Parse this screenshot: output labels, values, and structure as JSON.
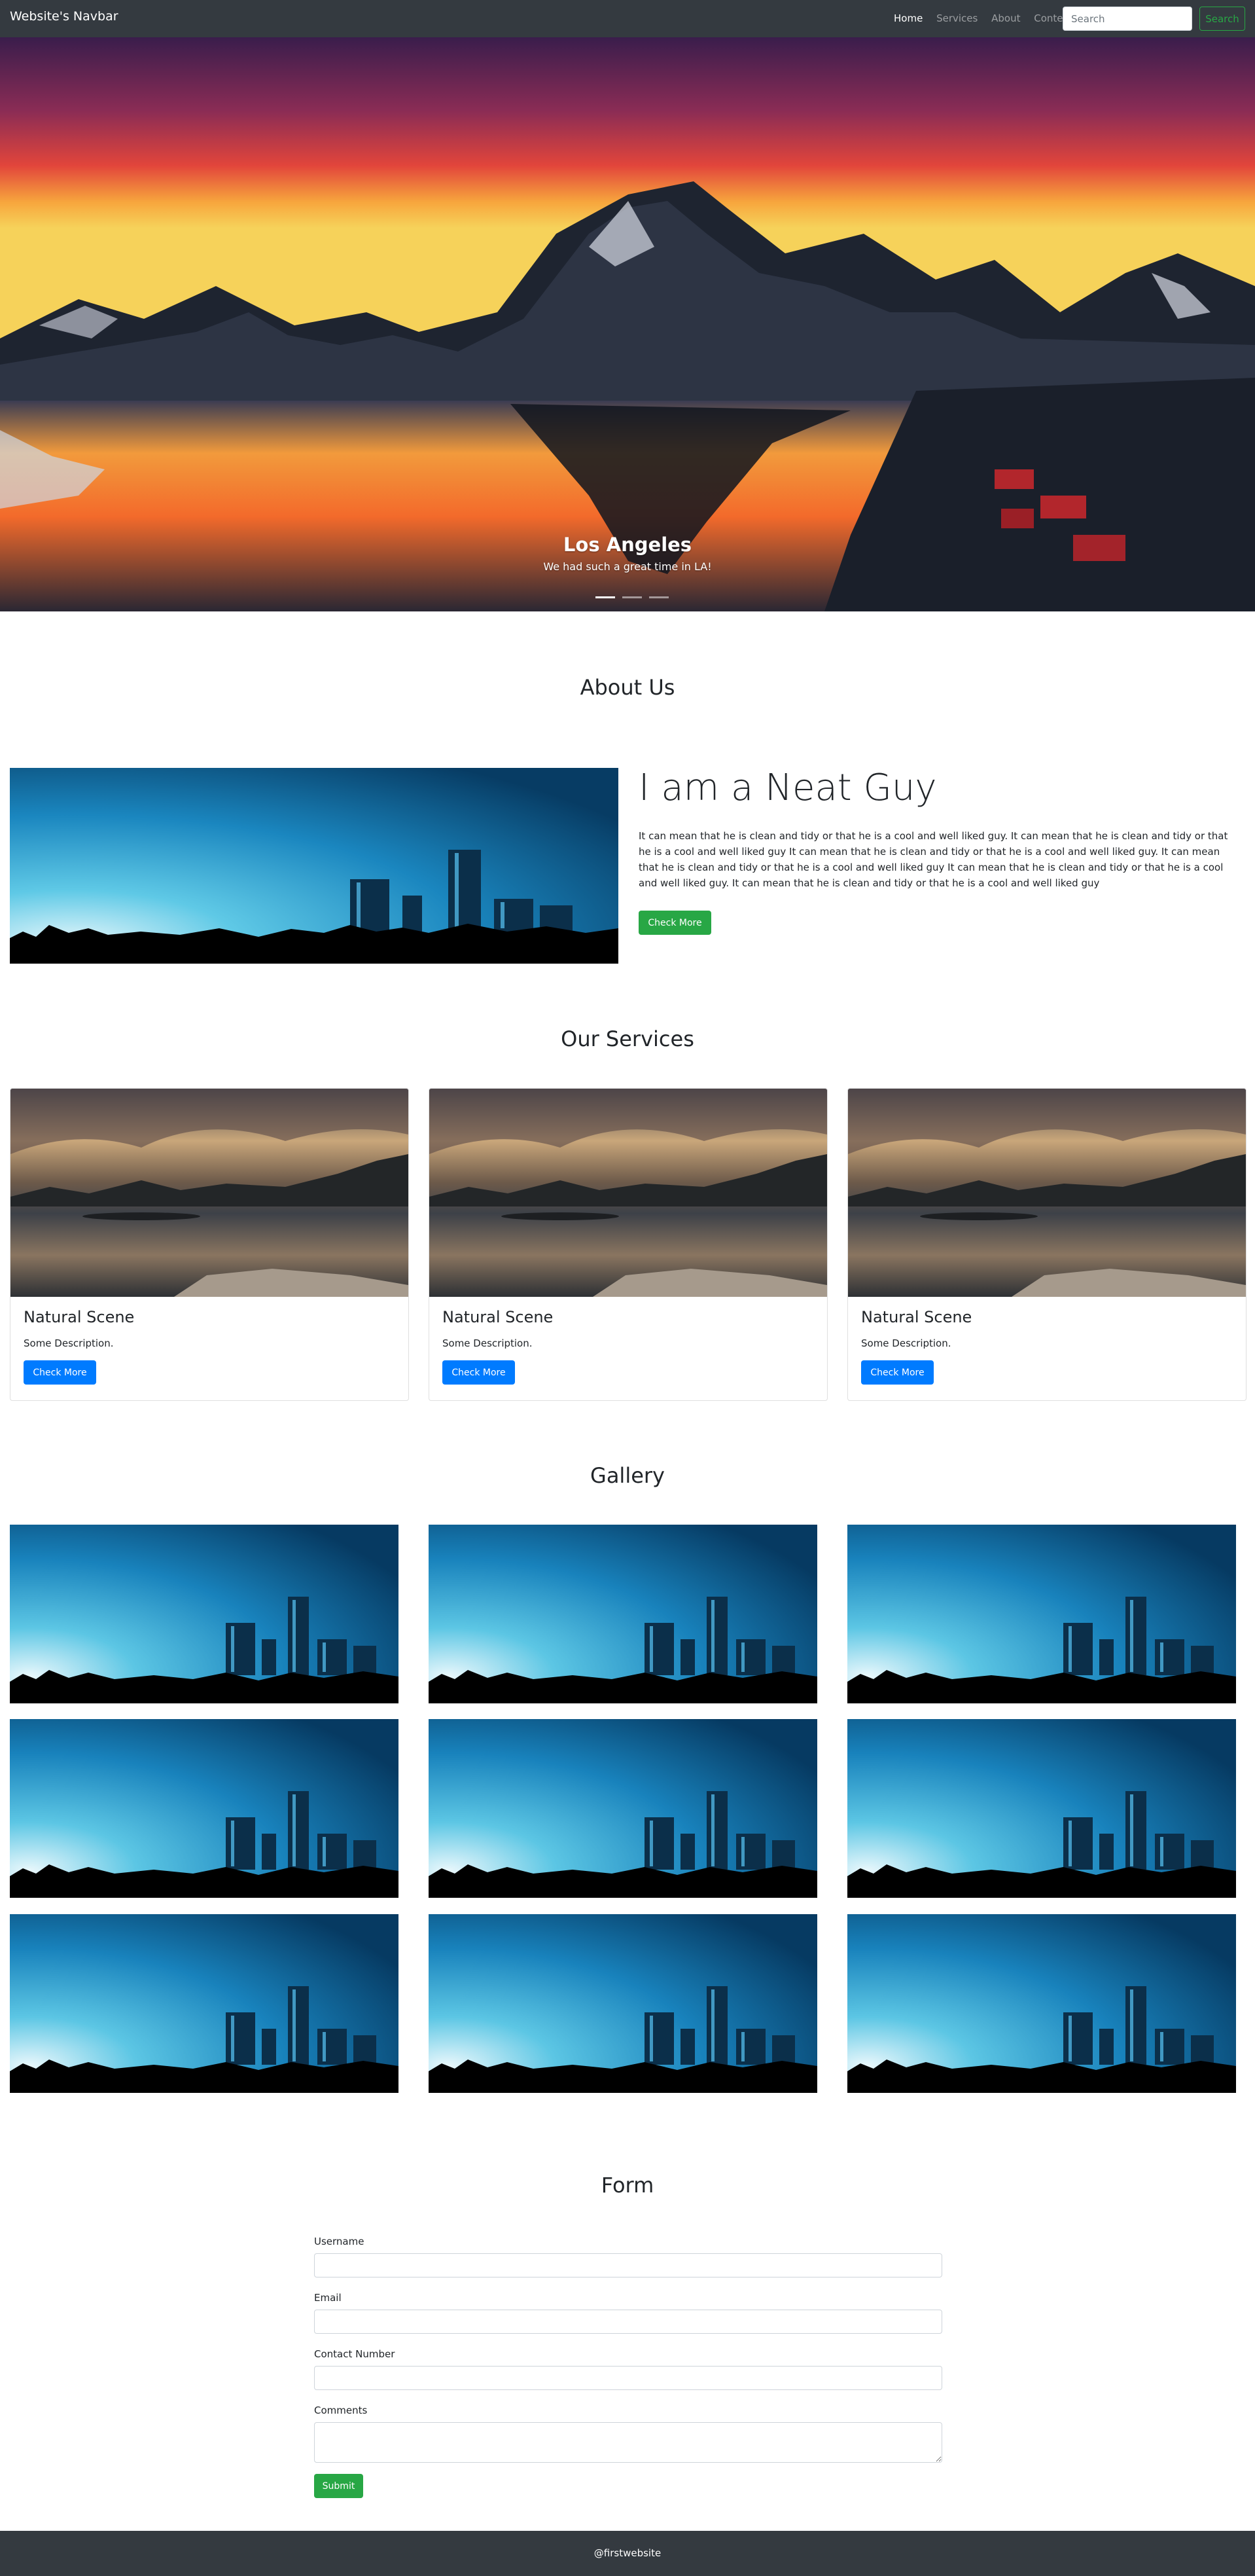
{
  "navbar": {
    "brand": "Website's Navbar",
    "links": [
      "Home",
      "Services",
      "About",
      "Content"
    ],
    "active_link": "Home",
    "search_placeholder": "Search",
    "search_button": "Search"
  },
  "carousel": {
    "caption_title": "Los Angeles",
    "caption_text": "We had such a great time in LA!",
    "slide_count": 3,
    "active_slide": 1
  },
  "about": {
    "section_title": "About Us",
    "heading": "I am a Neat Guy",
    "text": "It can mean that he is clean and tidy or that he is a cool and well liked guy. It can mean that he is clean and tidy or that he is a cool and well liked guy It can mean that he is clean and tidy or that he is a cool and well liked guy. It can mean that he is clean and tidy or that he is a cool and well liked guy It can mean that he is clean and tidy or that he is a cool and well liked guy. It can mean that he is clean and tidy or that he is a cool and well liked guy",
    "button": "Check More"
  },
  "services": {
    "section_title": "Our Services",
    "cards": [
      {
        "title": "Natural Scene",
        "description": "Some Description.",
        "button": "Check More"
      },
      {
        "title": "Natural Scene",
        "description": "Some Description.",
        "button": "Check More"
      },
      {
        "title": "Natural Scene",
        "description": "Some Description.",
        "button": "Check More"
      }
    ]
  },
  "gallery": {
    "section_title": "Gallery",
    "image_count": 9
  },
  "form": {
    "section_title": "Form",
    "fields": [
      {
        "label": "Username",
        "value": ""
      },
      {
        "label": "Email",
        "value": ""
      },
      {
        "label": "Contact Number",
        "value": ""
      },
      {
        "label": "Comments",
        "value": ""
      }
    ],
    "submit": "Submit"
  },
  "footer": {
    "text": "@firstwebsite"
  },
  "colors": {
    "navbar_bg": "#343a40",
    "success": "#28a745",
    "primary": "#007bff"
  }
}
